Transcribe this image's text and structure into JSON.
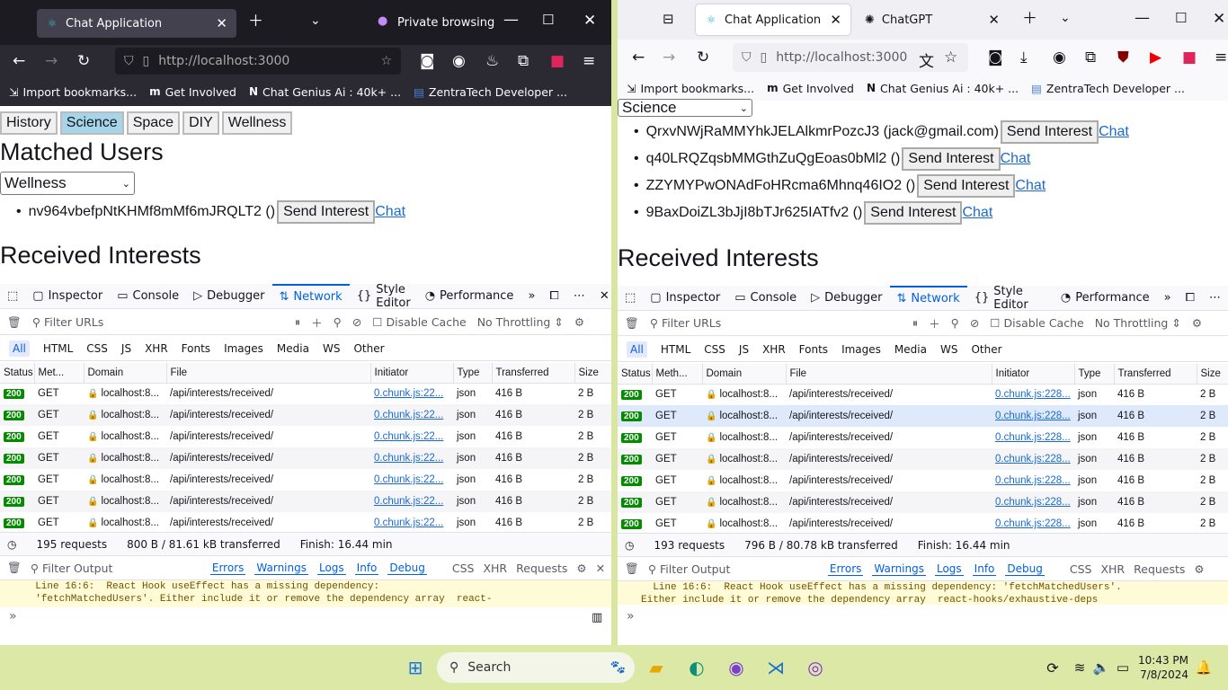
{
  "left": {
    "tab_title": "Chat Application",
    "private_label": "Private browsing",
    "url": "http://localhost:3000",
    "bookmarks": [
      "Import bookmarks...",
      "Get Involved",
      "Chat Genius Ai : 40k+ ...",
      "ZentraTech Developer ..."
    ],
    "interests": [
      "History",
      "Science",
      "Space",
      "DIY",
      "Wellness"
    ],
    "matched_heading": "Matched Users",
    "select_value": "Wellness",
    "users": [
      {
        "name": "nv964vbefpNtKHMf8mMf6mJRQLT2 ()",
        "button": "Send Interest",
        "link": "Chat"
      }
    ],
    "received_heading": "Received Interests",
    "status_summary": [
      "195 requests",
      "800 B / 81.61 kB transferred",
      "Finish: 16.44 min"
    ],
    "warning": [
      "  Line 16:6:  React Hook useEffect has a missing dependency:",
      "  'fetchMatchedUsers'. Either include it or remove the dependency array  react-"
    ]
  },
  "right": {
    "tab_title": "Chat Application",
    "tab2_title": "ChatGPT",
    "url": "http://localhost:3000",
    "bookmarks": [
      "Import bookmarks...",
      "Get Involved",
      "Chat Genius Ai : 40k+ ...",
      "ZentraTech Developer ..."
    ],
    "select_value": "Science",
    "users": [
      {
        "name": "QrxvNWjRaMMYhkJELAlkmrPozcJ3 (jack@gmail.com)",
        "button": "Send Interest",
        "link": "Chat"
      },
      {
        "name": "q40LRQZqsbMMGthZuQgEoas0bMl2 ()",
        "button": "Send Interest",
        "link": "Chat"
      },
      {
        "name": "ZZYMYPwONAdFoHRcma6Mhnq46IO2 ()",
        "button": "Send Interest",
        "link": "Chat"
      },
      {
        "name": "9BaxDoiZL3bJjI8bTJr625IATfv2 ()",
        "button": "Send Interest",
        "link": "Chat"
      }
    ],
    "received_heading": "Received Interests",
    "status_summary": [
      "193 requests",
      "796 B / 80.78 kB transferred",
      "Finish: 16.44 min"
    ],
    "warning": [
      "  Line 16:6:  React Hook useEffect has a missing dependency: 'fetchMatchedUsers'.",
      "Either include it or remove the dependency array  react-hooks/exhaustive-deps"
    ]
  },
  "devtools": {
    "tabs": [
      "Inspector",
      "Console",
      "Debugger",
      "Network",
      "Style Editor",
      "Performance"
    ],
    "filter_placeholder": "Filter URLs",
    "disable_cache": "Disable Cache",
    "throttling": "No Throttling",
    "types": [
      "All",
      "HTML",
      "CSS",
      "JS",
      "XHR",
      "Fonts",
      "Images",
      "Media",
      "WS",
      "Other"
    ],
    "columns_left": [
      "Status",
      "Met...",
      "Domain",
      "File",
      "Initiator",
      "Type",
      "Transferred",
      "Size"
    ],
    "columns_right": [
      "Status",
      "Meth...",
      "Domain",
      "File",
      "Initiator",
      "Type",
      "Transferred",
      "Size"
    ],
    "row": {
      "status": "200",
      "method": "GET",
      "domain": "localhost:8...",
      "file": "/api/interests/received/",
      "initiator_left": "0.chunk.js:22...",
      "initiator_right": "0.chunk.js:228...",
      "type": "json",
      "transferred": "416 B",
      "size": "2 B"
    },
    "filter_output": "Filter Output",
    "log_levels": [
      "Errors",
      "Warnings",
      "Logs",
      "Info",
      "Debug"
    ],
    "log_extra": [
      "CSS",
      "XHR",
      "Requests"
    ]
  },
  "taskbar": {
    "search": "Search",
    "time": "10:43 PM",
    "date": "7/8/2024"
  }
}
